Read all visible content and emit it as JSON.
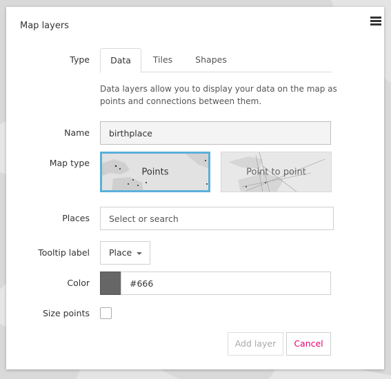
{
  "dialog": {
    "title": "Map layers",
    "menu_icon": "hamburger-menu-icon"
  },
  "form": {
    "type_label": "Type",
    "tabs": [
      {
        "label": "Data",
        "active": true
      },
      {
        "label": "Tiles",
        "active": false
      },
      {
        "label": "Shapes",
        "active": false
      }
    ],
    "description": "Data layers allow you to display your data on the map as points and connections between them.",
    "name_label": "Name",
    "name_value": "birthplace",
    "map_type_label": "Map type",
    "map_types": [
      {
        "label": "Points",
        "selected": true
      },
      {
        "label": "Point to point",
        "selected": false
      }
    ],
    "places_label": "Places",
    "places_placeholder": "Select or search",
    "tooltip_label": "Tooltip label",
    "tooltip_value": "Place",
    "color_label": "Color",
    "color_value": "#666",
    "size_points_label": "Size points",
    "size_points_checked": false
  },
  "actions": {
    "add_layer": "Add layer",
    "cancel": "Cancel"
  },
  "colors": {
    "selected_border": "#5ab0d9",
    "cancel_text": "#e5006d",
    "swatch": "#666666"
  }
}
